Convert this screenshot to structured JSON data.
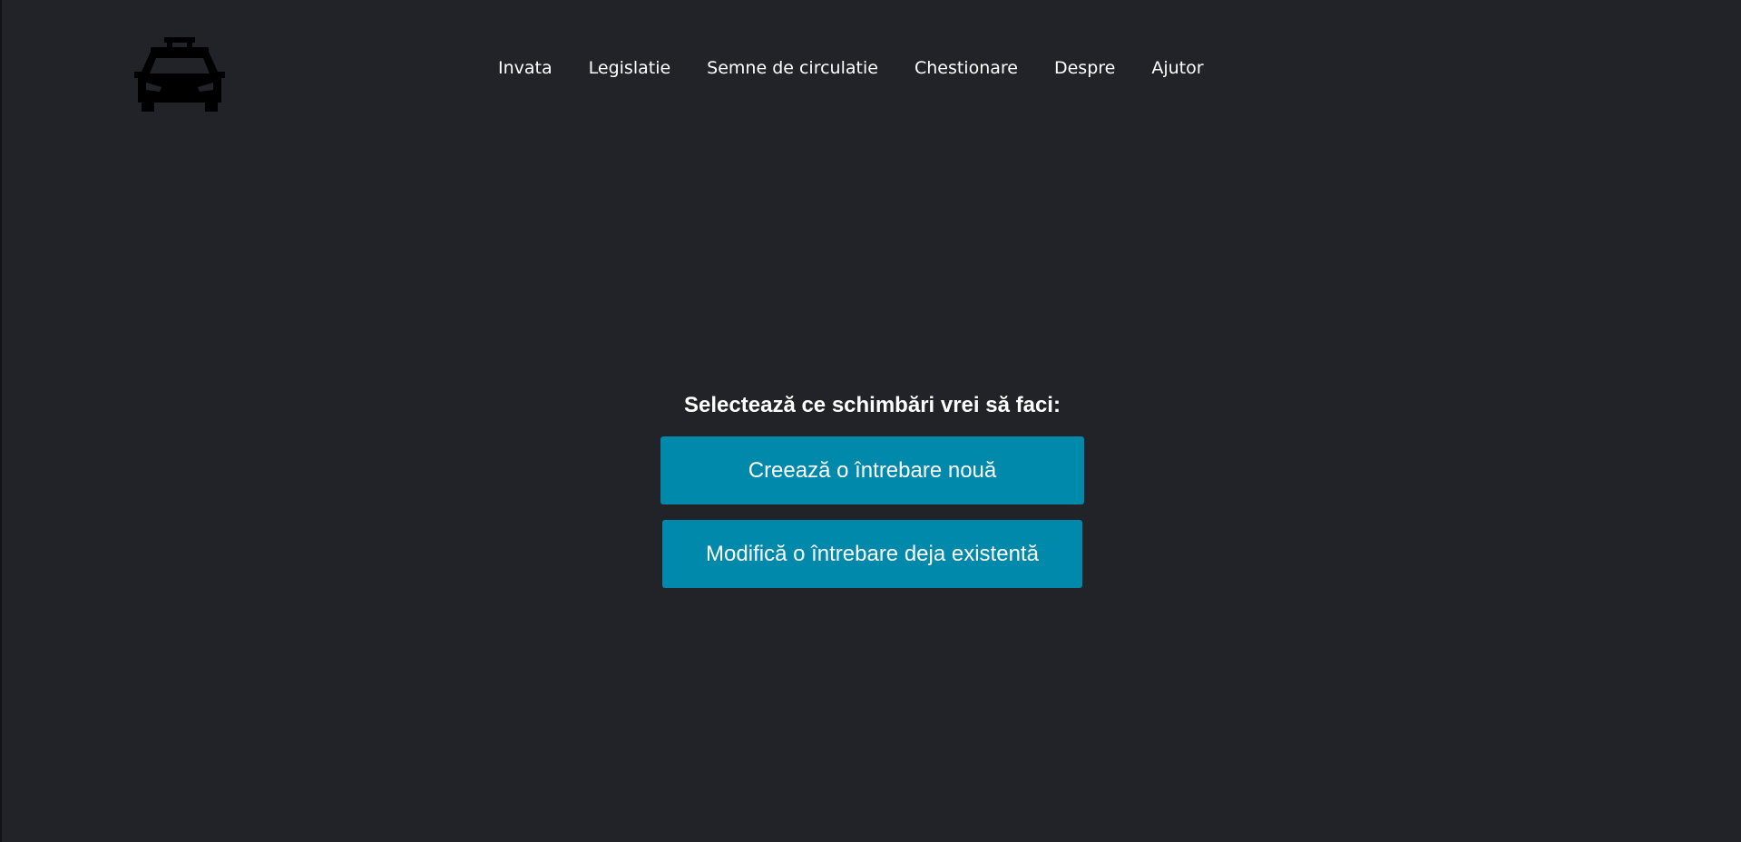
{
  "header": {
    "logo_icon": "taxi-car-icon",
    "nav": [
      {
        "label": "Invata"
      },
      {
        "label": "Legislatie"
      },
      {
        "label": "Semne de circulatie"
      },
      {
        "label": "Chestionare"
      },
      {
        "label": "Despre"
      },
      {
        "label": "Ajutor"
      }
    ]
  },
  "main": {
    "heading": "Selectează ce schimbări vrei să faci:",
    "create_button": "Creează o întrebare nouă",
    "modify_button": "Modifică o întrebare deja existentă"
  },
  "colors": {
    "background": "#222328",
    "button": "#0089ab",
    "text": "#ffffff"
  }
}
